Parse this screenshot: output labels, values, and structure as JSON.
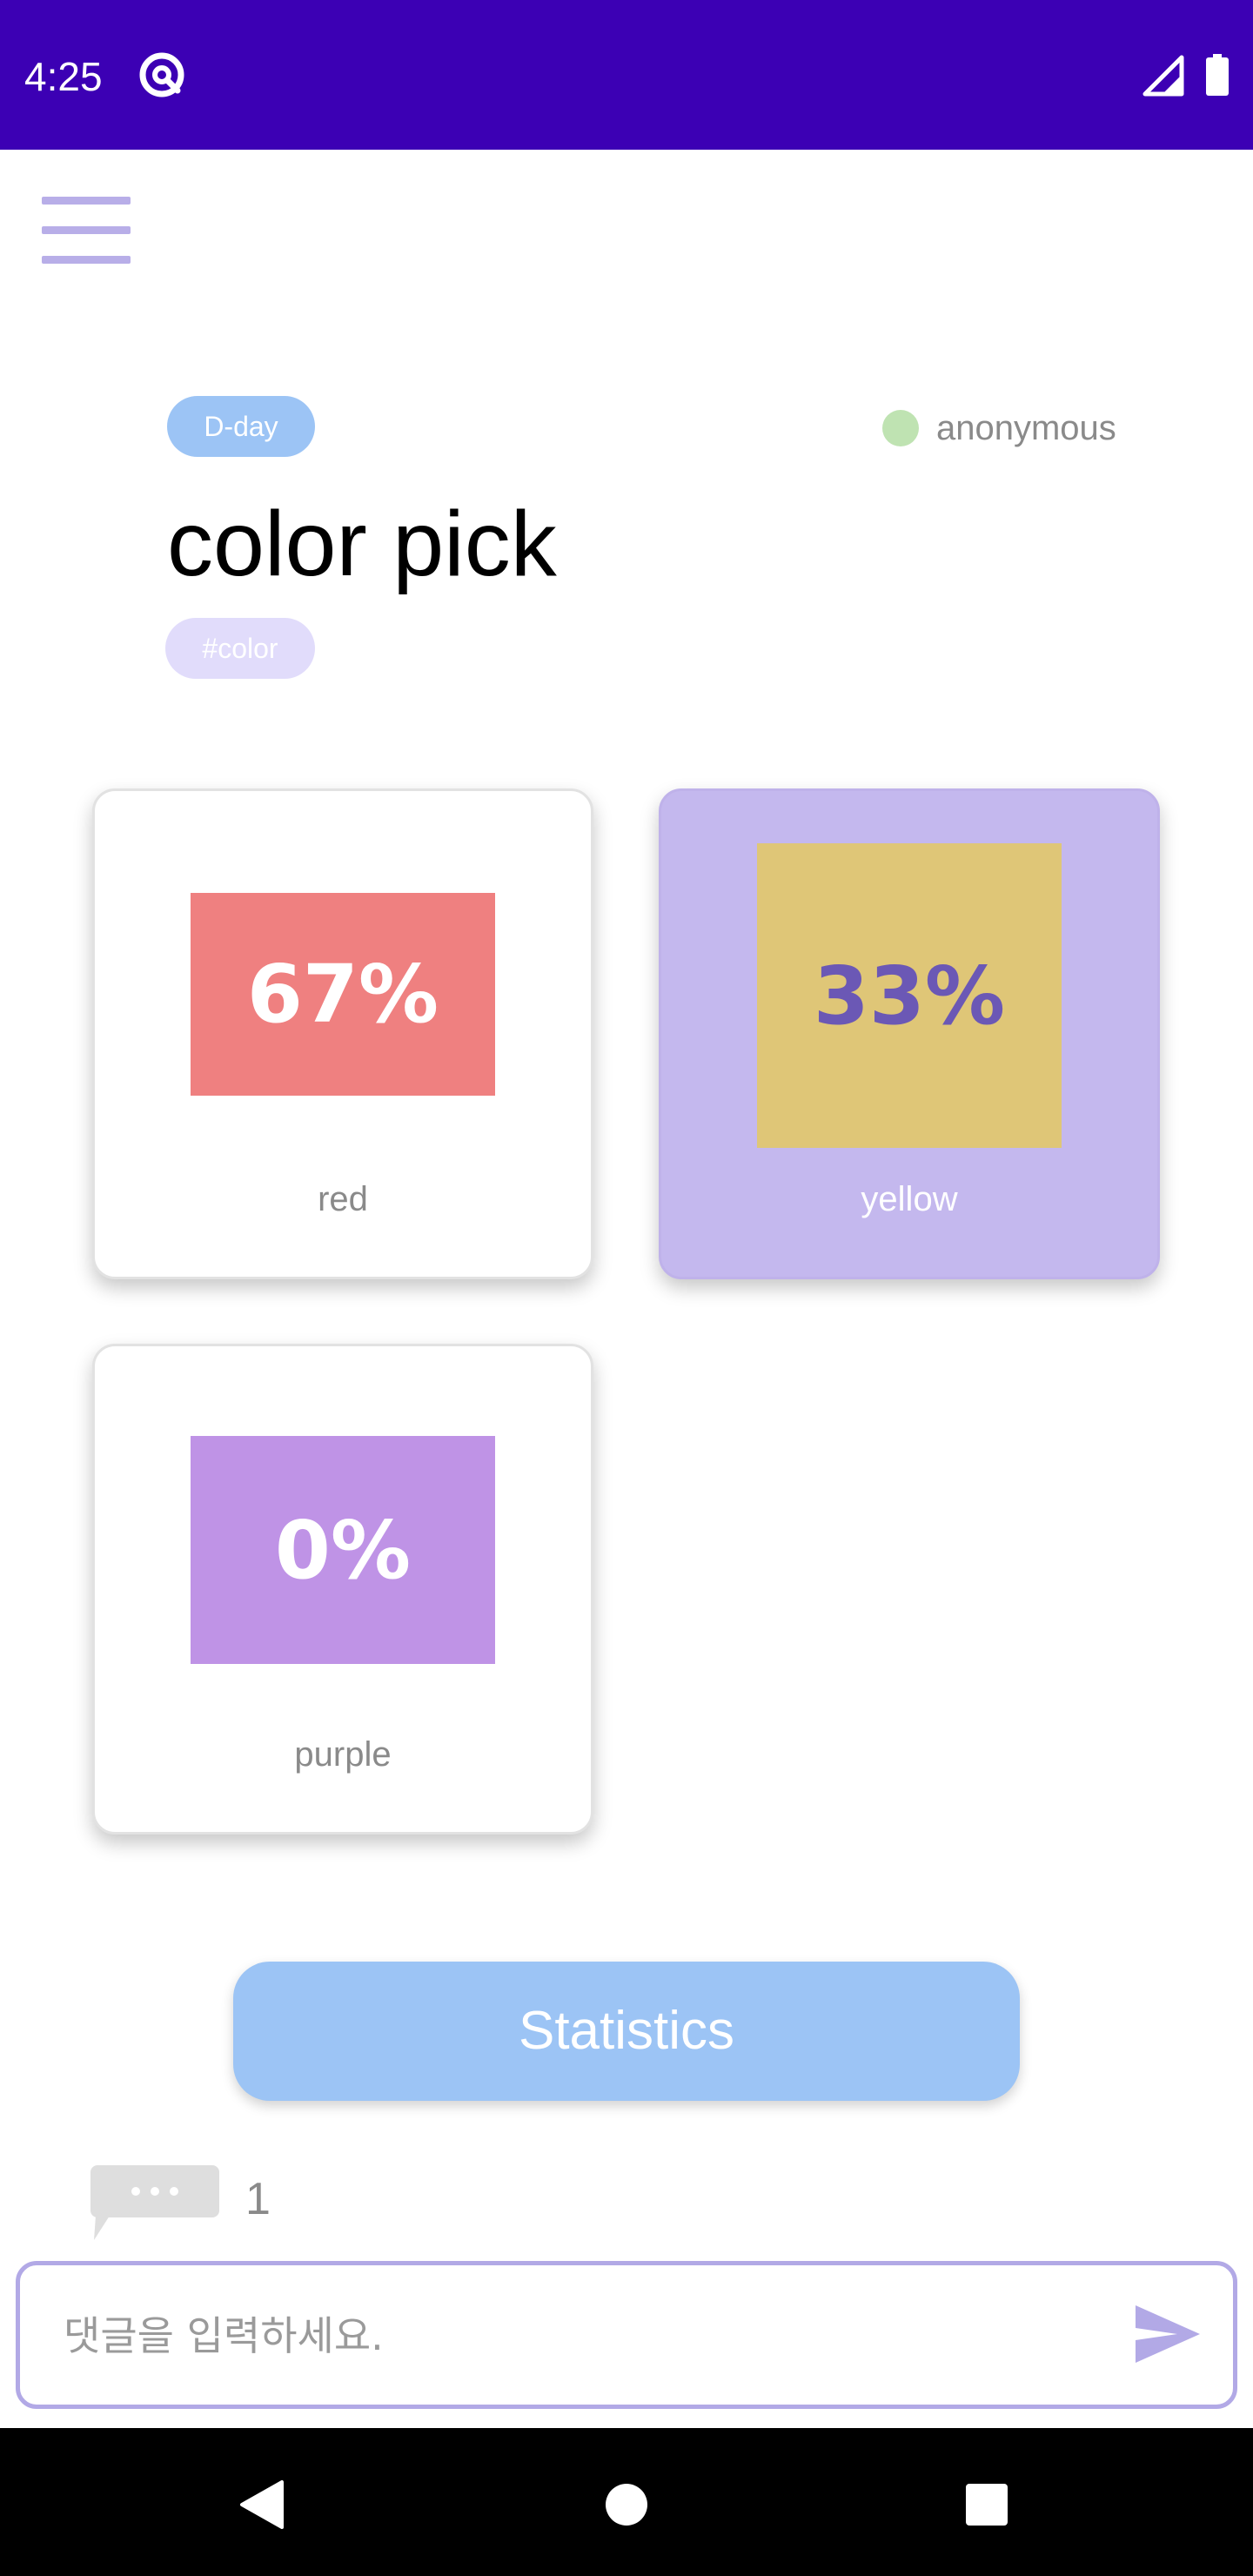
{
  "status_bar": {
    "time": "4:25",
    "background": "#3c00b4",
    "app_icon": "at-sign-icon",
    "signal_icon": "signal-icon",
    "battery_icon": "battery-icon"
  },
  "menu": {
    "icon": "hamburger-menu-icon"
  },
  "post": {
    "badge": "D-day",
    "author": "anonymous",
    "title": "color pick",
    "tag": "#color"
  },
  "options": [
    {
      "label": "red",
      "percent": "67%",
      "color": "#ef8080",
      "selected": false
    },
    {
      "label": "yellow",
      "percent": "33%",
      "color": "#dfc677",
      "selected": true
    },
    {
      "label": "purple",
      "percent": "0%",
      "color": "#bf93e6",
      "selected": false
    }
  ],
  "actions": {
    "statistics_label": "Statistics"
  },
  "comments": {
    "count": "1",
    "placeholder": "댓글을 입력하세요.",
    "send_icon": "send-icon"
  },
  "colors": {
    "accent": "#b2a9e6",
    "badge_blue": "#9cc4f5",
    "selected_card": "#c4b8ee",
    "selected_percent_text": "#6b58b5"
  }
}
